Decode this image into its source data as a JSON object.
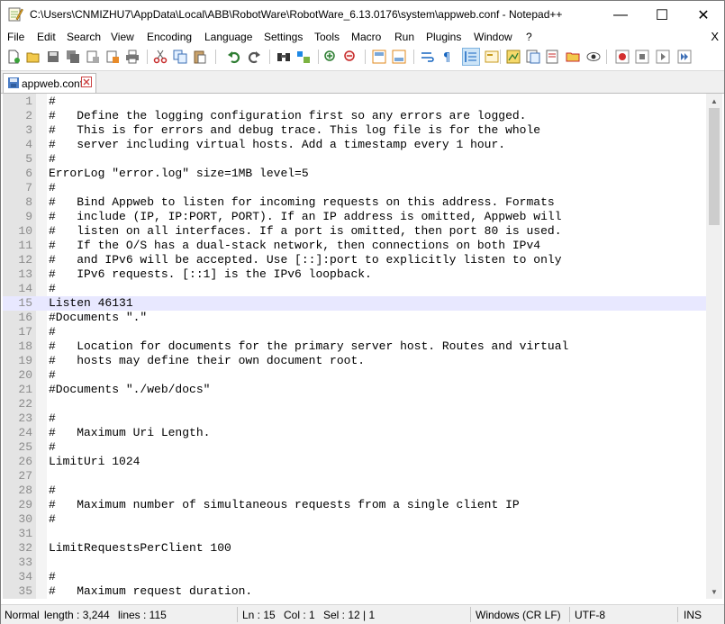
{
  "window": {
    "title": "C:\\Users\\CNMIZHU7\\AppData\\Local\\ABB\\RobotWare\\RobotWare_6.13.0176\\system\\appweb.conf - Notepad++",
    "minimize_glyph": "—",
    "maximize_glyph": "☐",
    "close_glyph": "✕"
  },
  "menu": {
    "items": [
      "File",
      "Edit",
      "Search",
      "View",
      "Encoding",
      "Language",
      "Settings",
      "Tools",
      "Macro",
      "Run",
      "Plugins",
      "Window",
      "?"
    ],
    "close_doc": "X"
  },
  "toolbar": {
    "icons": [
      "new-file-icon",
      "open-file-icon",
      "save-icon",
      "save-all-icon",
      "close-icon",
      "close-all-icon",
      "print-icon",
      "cut-icon",
      "copy-icon",
      "paste-icon",
      "undo-icon",
      "redo-icon",
      "find-icon",
      "replace-icon",
      "zoom-in-icon",
      "zoom-out-icon",
      "sync-vertical-icon",
      "sync-horizontal-icon",
      "word-wrap-icon",
      "show-all-chars-icon",
      "indent-guide-icon",
      "udl-icon",
      "doc-map-icon",
      "function-list-icon",
      "folder-workspace-icon",
      "monitor-icon",
      "record-macro-icon",
      "stop-macro-icon",
      "play-macro-icon",
      "run-macro-multiple-icon",
      "save-macro-icon"
    ]
  },
  "tab": {
    "label": "appweb.conf"
  },
  "editor": {
    "current_line": 15,
    "lines": [
      {
        "n": "1",
        "text": "#"
      },
      {
        "n": "2",
        "text": "#   Define the logging configuration first so any errors are logged."
      },
      {
        "n": "3",
        "text": "#   This is for errors and debug trace. This log file is for the whole"
      },
      {
        "n": "4",
        "text": "#   server including virtual hosts. Add a timestamp every 1 hour."
      },
      {
        "n": "5",
        "text": "#"
      },
      {
        "n": "6",
        "text": "ErrorLog \"error.log\" size=1MB level=5"
      },
      {
        "n": "7",
        "text": "#"
      },
      {
        "n": "8",
        "text": "#   Bind Appweb to listen for incoming requests on this address. Formats"
      },
      {
        "n": "9",
        "text": "#   include (IP, IP:PORT, PORT). If an IP address is omitted, Appweb will"
      },
      {
        "n": "10",
        "text": "#   listen on all interfaces. If a port is omitted, then port 80 is used."
      },
      {
        "n": "11",
        "text": "#   If the O/S has a dual-stack network, then connections on both IPv4"
      },
      {
        "n": "12",
        "text": "#   and IPv6 will be accepted. Use [::]:port to explicitly listen to only"
      },
      {
        "n": "13",
        "text": "#   IPv6 requests. [::1] is the IPv6 loopback."
      },
      {
        "n": "14",
        "text": "#"
      },
      {
        "n": "15",
        "text": "Listen 46131"
      },
      {
        "n": "16",
        "text": "#Documents \".\""
      },
      {
        "n": "17",
        "text": "#"
      },
      {
        "n": "18",
        "text": "#   Location for documents for the primary server host. Routes and virtual"
      },
      {
        "n": "19",
        "text": "#   hosts may define their own document root."
      },
      {
        "n": "20",
        "text": "#"
      },
      {
        "n": "21",
        "text": "#Documents \"./web/docs\""
      },
      {
        "n": "22",
        "text": ""
      },
      {
        "n": "23",
        "text": "#"
      },
      {
        "n": "24",
        "text": "#   Maximum Uri Length."
      },
      {
        "n": "25",
        "text": "#"
      },
      {
        "n": "26",
        "text": "LimitUri 1024"
      },
      {
        "n": "27",
        "text": ""
      },
      {
        "n": "28",
        "text": "#"
      },
      {
        "n": "29",
        "text": "#   Maximum number of simultaneous requests from a single client IP"
      },
      {
        "n": "30",
        "text": "#"
      },
      {
        "n": "31",
        "text": ""
      },
      {
        "n": "32",
        "text": "LimitRequestsPerClient 100"
      },
      {
        "n": "33",
        "text": ""
      },
      {
        "n": "34",
        "text": "#"
      },
      {
        "n": "35",
        "text": "#   Maximum request duration."
      }
    ]
  },
  "status": {
    "mode": "Normal",
    "length": "length : 3,244",
    "lines": "lines : 115",
    "ln": "Ln : 15",
    "col": "Col : 1",
    "sel": "Sel : 12 | 1",
    "eol": "Windows (CR LF)",
    "encoding": "UTF-8",
    "ins": "INS"
  }
}
